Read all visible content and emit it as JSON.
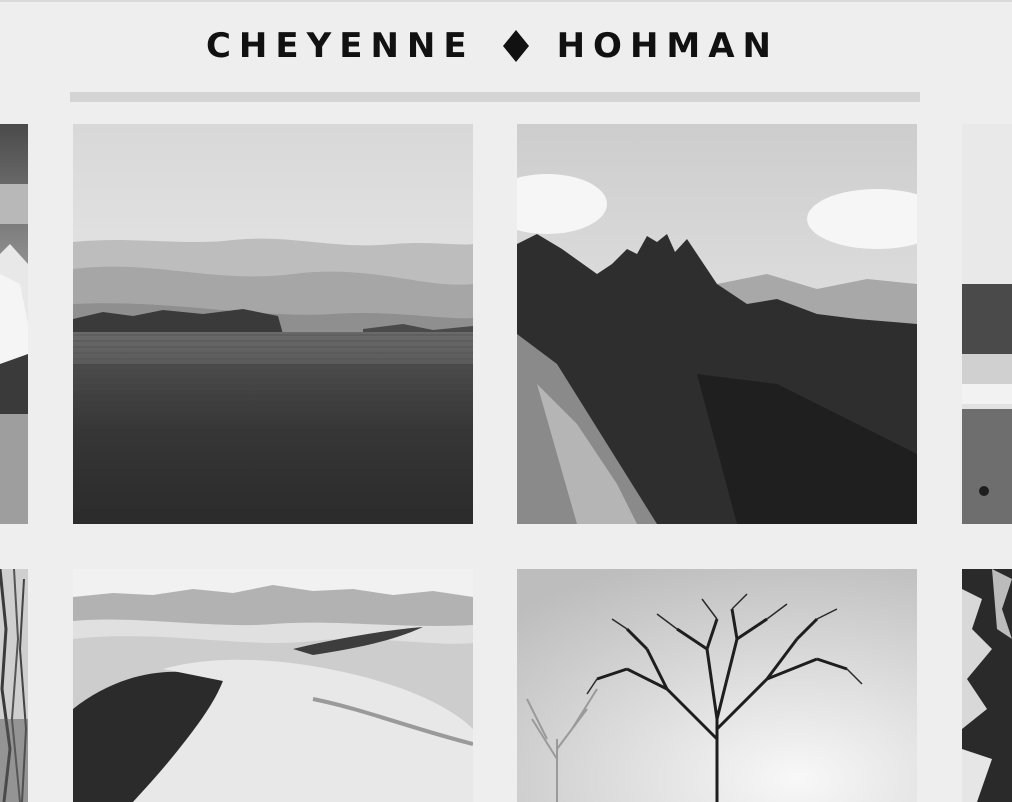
{
  "header": {
    "first_name": "CHEYENNE",
    "last_name": "HOHMAN",
    "separator_icon": "diamond-icon"
  },
  "gallery": {
    "photos": [
      {
        "name": "partial-snowy-mountain-photo"
      },
      {
        "name": "rolling-fields-photo"
      },
      {
        "name": "jagged-mountain-peaks-photo"
      },
      {
        "name": "partial-beach-waves-photo"
      },
      {
        "name": "partial-bare-branches-photo"
      },
      {
        "name": "sand-dunes-photo"
      },
      {
        "name": "lone-tree-photo"
      },
      {
        "name": "partial-snowy-rocks-photo"
      }
    ]
  },
  "colors": {
    "background": "#eeeeee",
    "text": "#111111",
    "rule": "#d4d4d4"
  }
}
